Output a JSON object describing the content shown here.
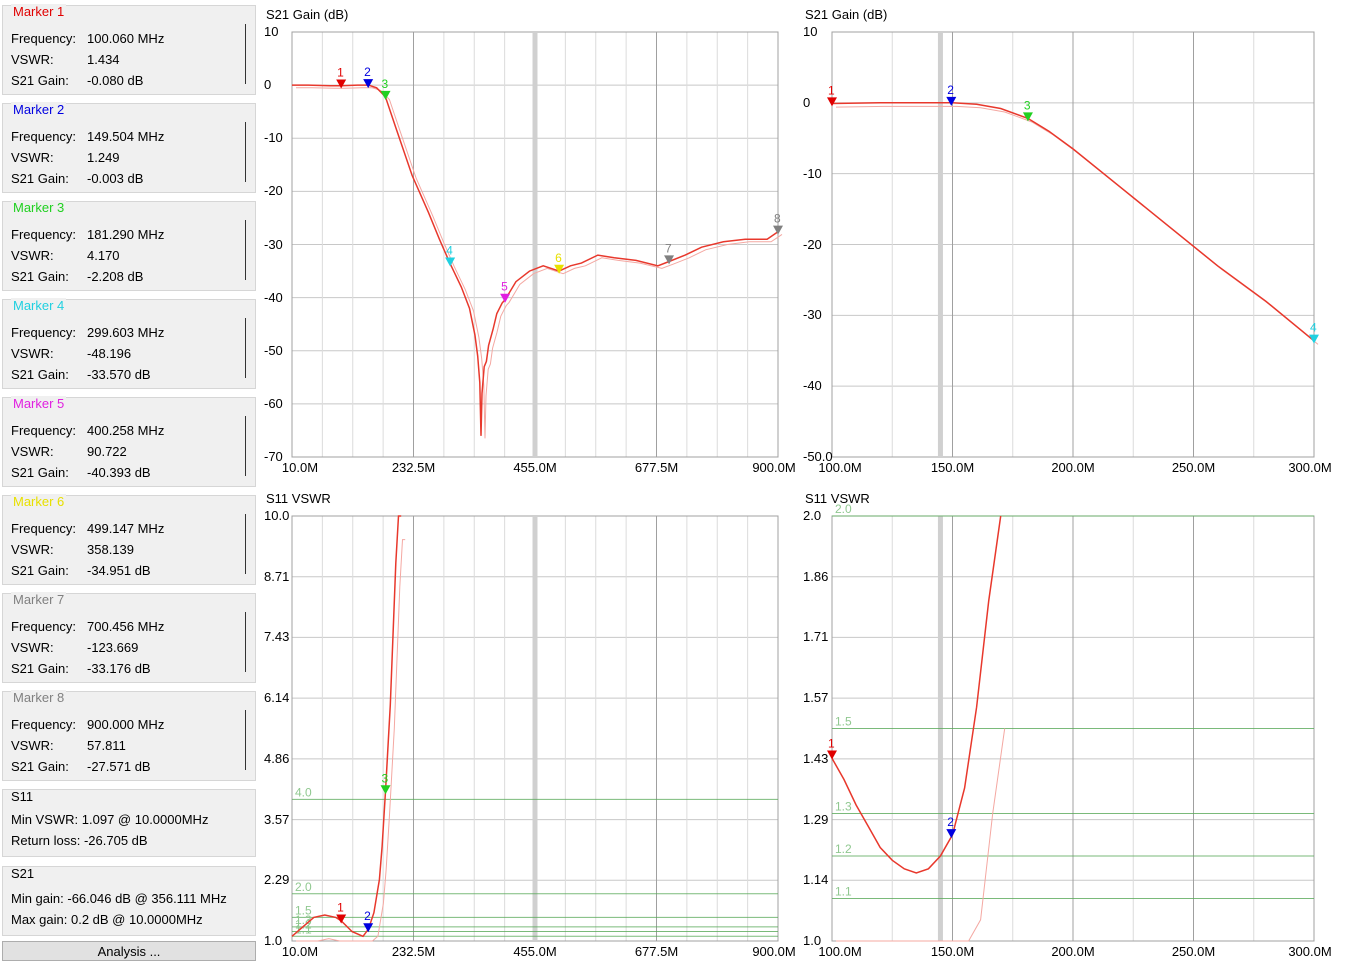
{
  "colors": {
    "trace": "#e8382c",
    "trace_ref": "#f4a8a2",
    "grid": "#c8c8c8",
    "grid_green": "#5aaa5a",
    "marker_1": "#e00000",
    "marker_2": "#0000e0",
    "marker_3": "#20d020",
    "marker_4": "#20d0e0",
    "marker_5": "#e020e0",
    "marker_6": "#e8e000",
    "marker_7": "#808080",
    "marker_8": "#808080"
  },
  "markers": [
    {
      "title": "Marker 1",
      "color": "#e00000",
      "freq_label": "Frequency:",
      "freq": "100.060 MHz",
      "vswr_label": "VSWR:",
      "vswr": "1.434",
      "gain_label": "S21 Gain:",
      "gain": "-0.080 dB"
    },
    {
      "title": "Marker 2",
      "color": "#0000e0",
      "freq_label": "Frequency:",
      "freq": "149.504 MHz",
      "vswr_label": "VSWR:",
      "vswr": "1.249",
      "gain_label": "S21 Gain:",
      "gain": "-0.003 dB"
    },
    {
      "title": "Marker 3",
      "color": "#20d020",
      "freq_label": "Frequency:",
      "freq": "181.290 MHz",
      "vswr_label": "VSWR:",
      "vswr": "4.170",
      "gain_label": "S21 Gain:",
      "gain": "-2.208 dB"
    },
    {
      "title": "Marker 4",
      "color": "#20d0e0",
      "freq_label": "Frequency:",
      "freq": "299.603 MHz",
      "vswr_label": "VSWR:",
      "vswr": "-48.196",
      "gain_label": "S21 Gain:",
      "gain": "-33.570 dB"
    },
    {
      "title": "Marker 5",
      "color": "#e020e0",
      "freq_label": "Frequency:",
      "freq": "400.258 MHz",
      "vswr_label": "VSWR:",
      "vswr": "90.722",
      "gain_label": "S21 Gain:",
      "gain": "-40.393 dB"
    },
    {
      "title": "Marker 6",
      "color": "#e8e000",
      "freq_label": "Frequency:",
      "freq": "499.147 MHz",
      "vswr_label": "VSWR:",
      "vswr": "358.139",
      "gain_label": "S21 Gain:",
      "gain": "-34.951 dB"
    },
    {
      "title": "Marker 7",
      "color": "#808080",
      "freq_label": "Frequency:",
      "freq": "700.456 MHz",
      "vswr_label": "VSWR:",
      "vswr": "-123.669",
      "gain_label": "S21 Gain:",
      "gain": "-33.176 dB"
    },
    {
      "title": "Marker 8",
      "color": "#808080",
      "freq_label": "Frequency:",
      "freq": "900.000 MHz",
      "vswr_label": "VSWR:",
      "vswr": "57.811",
      "gain_label": "S21 Gain:",
      "gain": "-27.571 dB"
    }
  ],
  "s11_summary": {
    "title": "S11",
    "min_vswr": "Min VSWR:  1.097 @ 10.0000MHz",
    "return_loss": "Return loss: -26.705 dB"
  },
  "s21_summary": {
    "title": "S21",
    "min_gain": "Min gain: -66.046 dB @ 356.111 MHz",
    "max_gain": "Max gain: 0.2 dB @ 10.0000MHz"
  },
  "analysis_button": "Analysis ...",
  "chart_data": [
    {
      "type": "line",
      "title": "S21  Gain (dB)",
      "yticks": [
        "10",
        "0",
        "-10",
        "-20",
        "-30",
        "-40",
        "-50",
        "-60",
        "-70"
      ],
      "xticks": [
        "10.0M",
        "232.5M",
        "455.0M",
        "677.5M",
        "900.0M"
      ],
      "xlim": [
        10,
        900
      ],
      "ylim": [
        -70,
        10
      ],
      "series": [
        {
          "x": [
            10,
            40,
            80,
            100,
            130,
            150,
            165,
            181,
            200,
            230,
            260,
            280,
            299.6,
            320,
            335,
            345,
            350,
            354,
            356.1,
            358,
            362,
            366,
            370,
            378,
            385,
            395,
            400.3,
            420,
            445,
            470,
            499.1,
            520,
            540,
            570,
            600,
            640,
            680,
            700.5,
            730,
            760,
            800,
            840,
            880,
            900
          ],
          "y": [
            0,
            0,
            -0.1,
            -0.1,
            0,
            0,
            -0.5,
            -2.2,
            -8,
            -17,
            -24,
            -29,
            -33.6,
            -38,
            -42,
            -47,
            -51,
            -56,
            -66,
            -58,
            -53,
            -52,
            -49,
            -46,
            -43,
            -41,
            -40.4,
            -37,
            -35,
            -34,
            -35,
            -34,
            -33.5,
            -32,
            -32.5,
            -33,
            -34,
            -33.2,
            -32,
            -30.5,
            -29.5,
            -29,
            -29,
            -27.6
          ]
        }
      ],
      "markers": [
        {
          "n": "1",
          "x": 100.06,
          "y": -0.08
        },
        {
          "n": "2",
          "x": 149.5,
          "y": 0
        },
        {
          "n": "3",
          "x": 181.29,
          "y": -2.2
        },
        {
          "n": "4",
          "x": 299.6,
          "y": -33.57
        },
        {
          "n": "5",
          "x": 400.26,
          "y": -40.39
        },
        {
          "n": "6",
          "x": 499.15,
          "y": -34.95
        },
        {
          "n": "7",
          "x": 700.46,
          "y": -33.18
        },
        {
          "n": "8",
          "x": 900,
          "y": -27.57
        }
      ]
    },
    {
      "type": "line",
      "title": "S21  Gain (dB)",
      "yticks": [
        "10",
        "0",
        "-10",
        "-20",
        "-30",
        "-40",
        "-50.0"
      ],
      "xticks": [
        "100.0M",
        "150.0M",
        "200.0M",
        "250.0M",
        "300.0M"
      ],
      "xlim": [
        100,
        300
      ],
      "ylim": [
        -50,
        10
      ],
      "series": [
        {
          "x": [
            100,
            120,
            140,
            150,
            160,
            170,
            181.3,
            190,
            200,
            220,
            240,
            260,
            280,
            300
          ],
          "y": [
            -0.1,
            0,
            0,
            0,
            -0.2,
            -0.8,
            -2.2,
            -4,
            -6.5,
            -12,
            -17.5,
            -23,
            -28,
            -33.6
          ]
        }
      ],
      "markers": [
        {
          "n": "1",
          "x": 100,
          "y": -0.08
        },
        {
          "n": "2",
          "x": 149.5,
          "y": 0
        },
        {
          "n": "3",
          "x": 181.3,
          "y": -2.2
        },
        {
          "n": "4",
          "x": 300,
          "y": -33.57
        }
      ]
    },
    {
      "type": "line",
      "title": "S11  VSWR",
      "yticks": [
        "10.0",
        "8.71",
        "7.43",
        "6.14",
        "4.86",
        "3.57",
        "2.29",
        "1.0"
      ],
      "xticks": [
        "10.0M",
        "232.5M",
        "455.0M",
        "677.5M",
        "900.0M"
      ],
      "xlim": [
        10,
        900
      ],
      "ylim": [
        1,
        10
      ],
      "ref_lines": [
        {
          "label": "4.0",
          "y": 4.0
        },
        {
          "label": "2.0",
          "y": 2.0
        },
        {
          "label": "1.5",
          "y": 1.5
        },
        {
          "label": "1.3",
          "y": 1.3
        },
        {
          "label": "1.2",
          "y": 1.2
        },
        {
          "label": "1.1",
          "y": 1.1
        }
      ],
      "series": [
        {
          "x": [
            10,
            30,
            50,
            70,
            90,
            100,
            120,
            140,
            150,
            160,
            170,
            175,
            181.3,
            190,
            200,
            205,
            210
          ],
          "y": [
            1.1,
            1.3,
            1.5,
            1.55,
            1.5,
            1.43,
            1.2,
            1.1,
            1.25,
            1.6,
            2.3,
            3,
            4.17,
            6,
            9,
            10,
            10
          ]
        }
      ],
      "markers": [
        {
          "n": "1",
          "x": 100.06,
          "y": 1.434
        },
        {
          "n": "2",
          "x": 149.5,
          "y": 1.249
        },
        {
          "n": "3",
          "x": 181.29,
          "y": 4.17
        }
      ]
    },
    {
      "type": "line",
      "title": "S11  VSWR",
      "yticks": [
        "2.0",
        "1.86",
        "1.71",
        "1.57",
        "1.43",
        "1.29",
        "1.14",
        "1.0"
      ],
      "xticks": [
        "100.0M",
        "150.0M",
        "200.0M",
        "250.0M",
        "300.0M"
      ],
      "xlim": [
        100,
        300
      ],
      "ylim": [
        1,
        2
      ],
      "ref_lines": [
        {
          "label": "2.0",
          "y": 2.0
        },
        {
          "label": "1.5",
          "y": 1.5
        },
        {
          "label": "1.3",
          "y": 1.3
        },
        {
          "label": "1.2",
          "y": 1.2
        },
        {
          "label": "1.1",
          "y": 1.1
        }
      ],
      "series": [
        {
          "x": [
            100,
            105,
            110,
            115,
            120,
            125,
            130,
            135,
            140,
            145,
            150,
            155,
            160,
            165,
            170
          ],
          "y": [
            1.43,
            1.38,
            1.32,
            1.27,
            1.22,
            1.19,
            1.17,
            1.16,
            1.17,
            1.2,
            1.25,
            1.36,
            1.55,
            1.8,
            2.0
          ]
        }
      ],
      "markers": [
        {
          "n": "1",
          "x": 100,
          "y": 1.434
        },
        {
          "n": "2",
          "x": 149.5,
          "y": 1.249
        }
      ]
    }
  ]
}
